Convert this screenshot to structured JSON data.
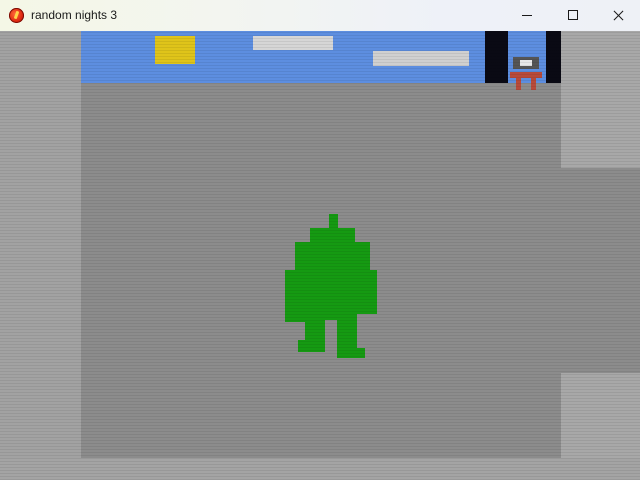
{
  "window": {
    "title": "random nights 3",
    "icon": "app-flame-icon",
    "controls": [
      "minimize-icon",
      "maximize-icon",
      "close-icon"
    ]
  },
  "scene": {
    "colors": {
      "sky": "#5d8ee0",
      "sun": "#dfc41a",
      "floor": "#8c8c8c",
      "wall": "#a2a2a2",
      "player": "#159a12",
      "enemy": "#b84a3a"
    },
    "sprites": [
      "sun",
      "cloud",
      "cloud",
      "window",
      "enemy-robot",
      "player-green-robot"
    ]
  }
}
